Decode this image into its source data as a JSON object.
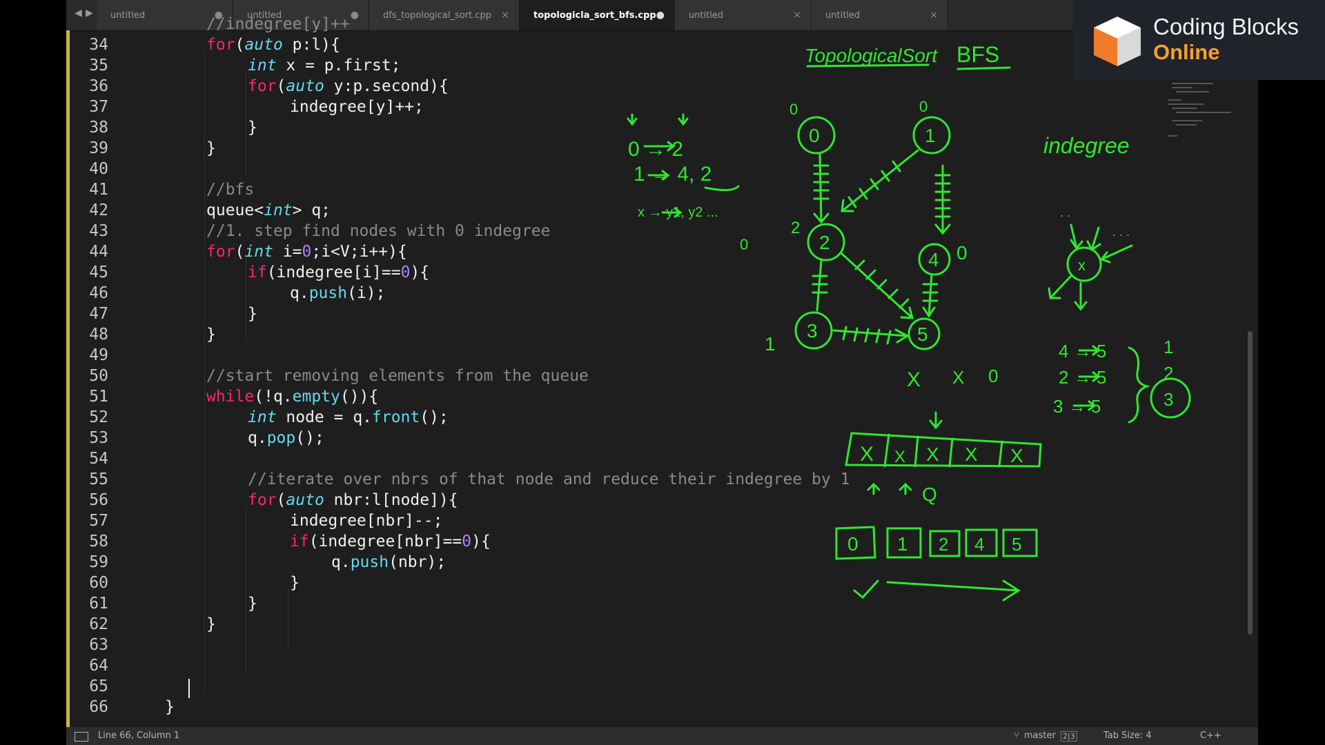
{
  "tabs": [
    {
      "label": "untitled",
      "marker": "●",
      "active": false
    },
    {
      "label": "untitled",
      "marker": "●",
      "active": false
    },
    {
      "label": "dfs_topological_sort.cpp",
      "marker": "×",
      "active": false
    },
    {
      "label": "topologicla_sort_bfs.cpp",
      "marker": "●",
      "active": true
    },
    {
      "label": "untitled",
      "marker": "×",
      "active": false
    },
    {
      "label": "untitled",
      "marker": "×",
      "active": false
    }
  ],
  "nav": {
    "back": "◀",
    "forward": "▶"
  },
  "line_numbers": [
    "34",
    "35",
    "36",
    "37",
    "38",
    "39",
    "40",
    "41",
    "42",
    "43",
    "44",
    "45",
    "46",
    "47",
    "48",
    "49",
    "50",
    "51",
    "52",
    "53",
    "54",
    "55",
    "56",
    "57",
    "58",
    "59",
    "60",
    "61",
    "62",
    "63",
    "64",
    "65",
    "66"
  ],
  "code": {
    "l34": [
      "//indegree[y]++"
    ],
    "l35": [
      "for",
      "(",
      "auto",
      " p:l){"
    ],
    "l36": [
      "int",
      " x = p.first;"
    ],
    "l37": [
      "for",
      "(",
      "auto",
      " y:p.second){"
    ],
    "l38": [
      "indegree[y]++;"
    ],
    "l39": [
      "}"
    ],
    "l40": [
      "}"
    ],
    "l42": [
      "//bfs"
    ],
    "l43": [
      "queue<",
      "int",
      "> q;"
    ],
    "l44": [
      "//1. step find nodes with 0 indegree"
    ],
    "l45": [
      "for",
      "(",
      "int",
      " i=",
      "0",
      ";i<V;i++){"
    ],
    "l46": [
      "if",
      "(indegree[i]==",
      "0",
      "){"
    ],
    "l47": [
      "q.",
      "push",
      "(i);"
    ],
    "l48": [
      "}"
    ],
    "l49": [
      "}"
    ],
    "l51": [
      "//start removing elements from the queue"
    ],
    "l52": [
      "while",
      "(!q.",
      "empty",
      "()){"
    ],
    "l53": [
      "int",
      " node = q.",
      "front",
      "();"
    ],
    "l54": [
      "q.",
      "pop",
      "();"
    ],
    "l56": [
      "//iterate over nbrs of that node and reduce their indegree by 1"
    ],
    "l57": [
      "for",
      "(",
      "auto",
      " nbr:l[node]){"
    ],
    "l58": [
      "indegree[nbr]--;"
    ],
    "l59": [
      "if",
      "(indegree[nbr]==",
      "0",
      "){"
    ],
    "l60": [
      "q.",
      "push",
      "(nbr);"
    ],
    "l61": [
      "}"
    ],
    "l62": [
      "}"
    ],
    "l63": [
      "}"
    ],
    "l66": [
      "}"
    ]
  },
  "status": {
    "position": "Line 66, Column 1",
    "branch": "master",
    "badge": "2|3",
    "tab_size": "Tab Size: 4",
    "syntax": "C++"
  },
  "logo": {
    "brand_line1": "Coding Blocks",
    "brand_line2": "Online"
  },
  "annotations": {
    "title": "TopologicalSort",
    "method": "BFS",
    "indegree_label": "indegree",
    "nodes": [
      "0",
      "1",
      "2",
      "3",
      "4",
      "5"
    ],
    "adjacency": [
      "0 → 2",
      "1 → 4, 2",
      "x → y1, y2 ..."
    ],
    "node_indegree": {
      "n0": "0",
      "n1": "0",
      "n2_a": "0",
      "n2_b": "2",
      "n4": "0",
      "n3": "1"
    },
    "removal_marks": [
      "X",
      "X",
      "0"
    ],
    "queue_cells": [
      "X",
      "X",
      "X",
      "X",
      "X"
    ],
    "queue_label": "Q",
    "output": [
      "0",
      "1",
      "2",
      "4",
      "5"
    ],
    "edges_to_5": [
      "4 → 5",
      "2 → 5",
      "3 → 5"
    ],
    "indegree_of_5": [
      "1",
      "2",
      "3"
    ],
    "generic_node": "x",
    "dots": ". . .",
    "dots_small": ". ."
  },
  "colors": {
    "ink": "#2ee82e",
    "bg": "#1e1e1e",
    "keyword": "#f92672",
    "type": "#66d9ef",
    "number": "#ae81ff",
    "comment": "#8a8a8a",
    "logo_accent": "#f5a02a"
  }
}
